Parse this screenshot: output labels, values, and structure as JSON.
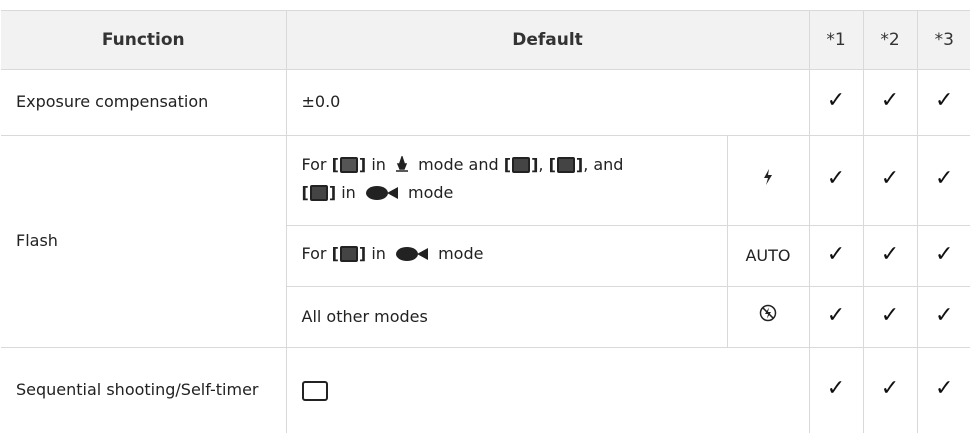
{
  "headers": {
    "function": "Function",
    "default": "Default",
    "c1": "*1",
    "c2": "*2",
    "c3": "*3"
  },
  "rows": {
    "exposure": {
      "function": "Exposure compensation",
      "default": "±0.0"
    },
    "flash": {
      "function": "Flash",
      "sub1": {
        "for": "For",
        "in1": "in",
        "mode_and": "mode and",
        "comma": ",",
        "and": ", and",
        "in2": "in",
        "mode": "mode",
        "value_icon": "flash-on-icon"
      },
      "sub2": {
        "for": "For",
        "in": "in",
        "mode": "mode",
        "value": "AUTO"
      },
      "sub3": {
        "label": "All other modes",
        "value_icon": "flash-off-icon"
      }
    },
    "sequential": {
      "function": "Sequential shooting/Self-timer",
      "default_icon": "single-frame-icon"
    }
  },
  "check_glyph": "✓"
}
